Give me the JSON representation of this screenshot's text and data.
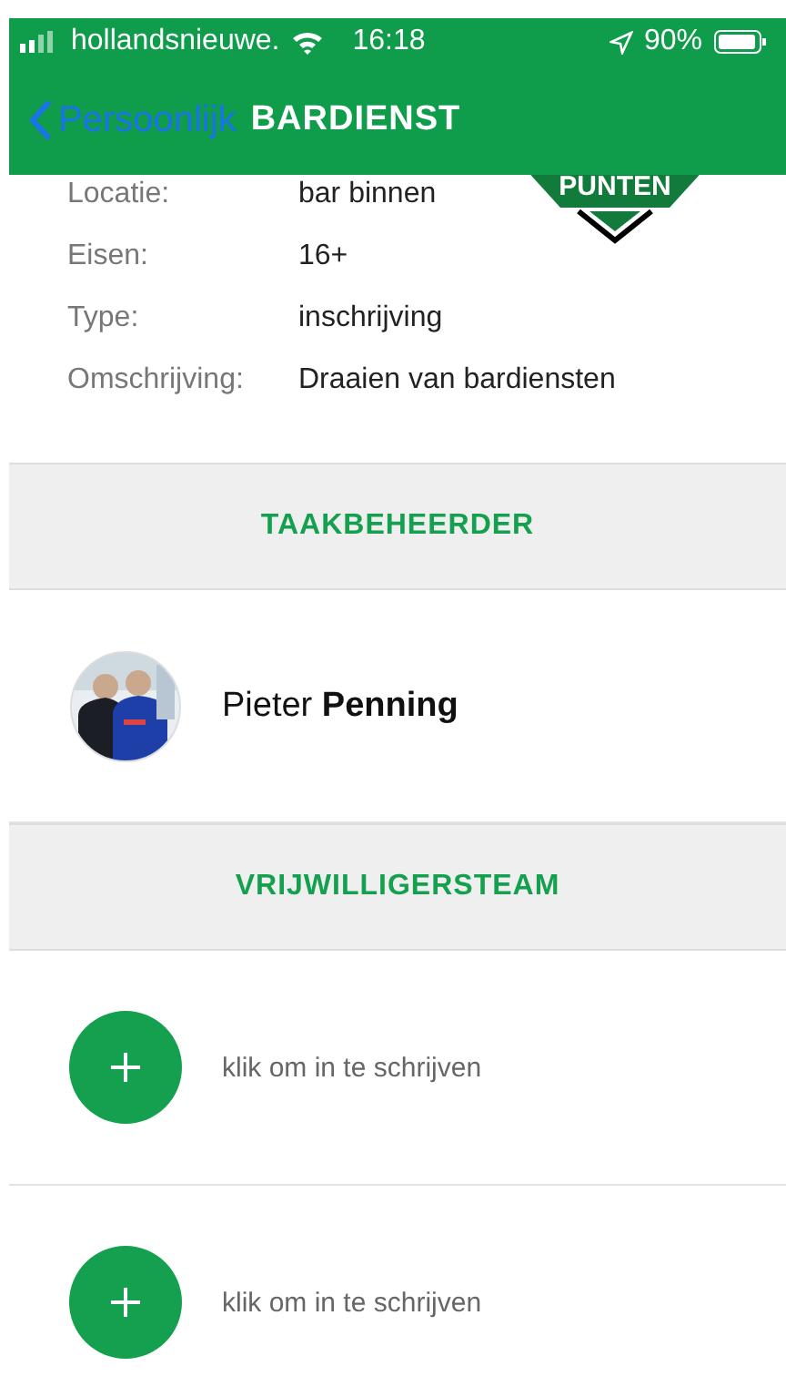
{
  "status_bar": {
    "carrier": "hollandsnieuwe.",
    "time": "16:18",
    "battery": "90%"
  },
  "nav": {
    "back_label": "Persoonlijk",
    "title": "BARDIENST"
  },
  "badge": {
    "text": "PUNTEN"
  },
  "details": [
    {
      "label": "Locatie:",
      "value": "bar binnen"
    },
    {
      "label": "Eisen:",
      "value": "16+"
    },
    {
      "label": "Type:",
      "value": "inschrijving"
    },
    {
      "label": "Omschrijving:",
      "value": "Draaien van bardiensten"
    }
  ],
  "sections": [
    {
      "title": "TAAKBEHEERDER",
      "items": [
        {
          "kind": "person",
          "name": "Pieter **Penning**"
        }
      ]
    },
    {
      "title": "VRIJWILLIGERSTEAM",
      "items": [
        {
          "kind": "signup",
          "label": "klik om in te schrijven"
        },
        {
          "kind": "signup",
          "label": "klik om in te schrijven"
        }
      ]
    }
  ]
}
